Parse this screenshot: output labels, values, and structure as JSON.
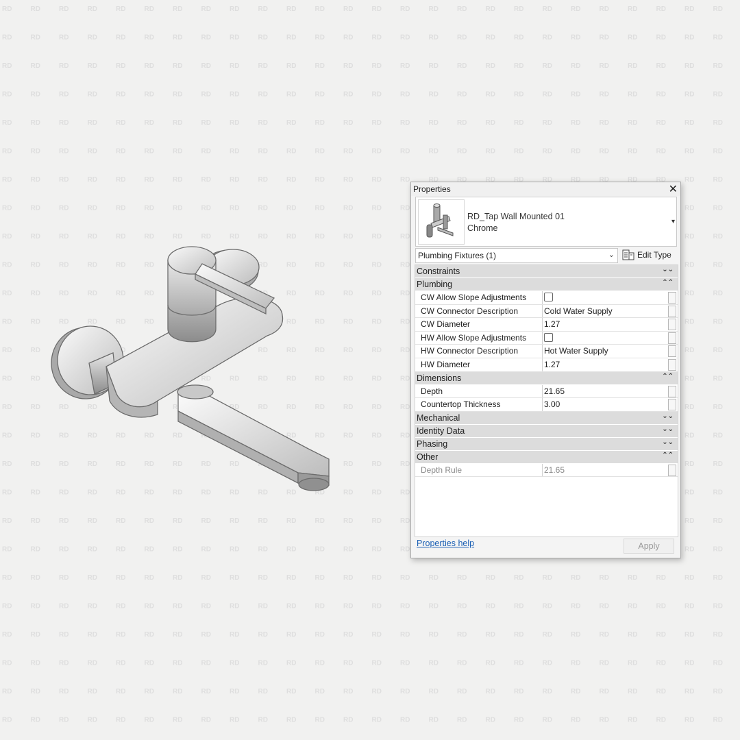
{
  "watermark_text": "RD",
  "model": {
    "icon": "tap-wall-mounted-model"
  },
  "properties_panel": {
    "title": "Properties",
    "close_glyph": "✕",
    "type_selector": {
      "name": "RD_Tap Wall Mounted 01",
      "material": "Chrome",
      "arrow": "▾"
    },
    "filter": {
      "label": "Plumbing Fixtures (1)",
      "chevron": "⌄"
    },
    "edit_type_label": "Edit Type",
    "groups": [
      {
        "label": "Constraints",
        "toggle": "⌄⌄"
      },
      {
        "label": "Plumbing",
        "toggle": "⌃⌃"
      },
      {
        "label": "Dimensions",
        "toggle": "⌃⌃"
      },
      {
        "label": "Mechanical",
        "toggle": "⌄⌄"
      },
      {
        "label": "Identity Data",
        "toggle": "⌄⌄"
      },
      {
        "label": "Phasing",
        "toggle": "⌄⌄"
      },
      {
        "label": "Other",
        "toggle": "⌃⌃"
      }
    ],
    "plumbing_rows": [
      {
        "name": "CW Allow Slope Adjustments",
        "value": "",
        "checked": false
      },
      {
        "name": "CW Connector Description",
        "value": "Cold Water Supply"
      },
      {
        "name": "CW Diameter",
        "value": "1.27"
      },
      {
        "name": "HW Allow Slope Adjustments",
        "value": "",
        "checked": false
      },
      {
        "name": "HW Connector Description",
        "value": "Hot Water Supply"
      },
      {
        "name": "HW Diameter",
        "value": "1.27"
      }
    ],
    "dimension_rows": [
      {
        "name": "Depth",
        "value": "21.65"
      },
      {
        "name": "Countertop Thickness",
        "value": "3.00"
      }
    ],
    "other_rows": [
      {
        "name": "Depth Rule",
        "value": "21.65"
      }
    ],
    "help_link": "Properties help",
    "apply_label": "Apply"
  }
}
